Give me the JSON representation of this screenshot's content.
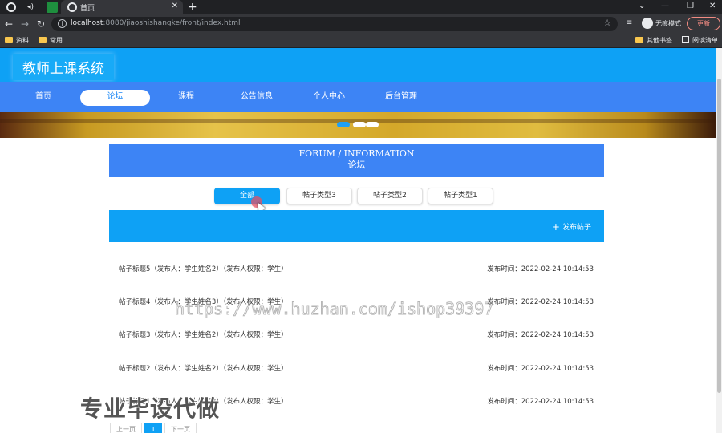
{
  "browser": {
    "tab_title": "首页",
    "url_host": "localhost",
    "url_path": ":8080/jiaoshishangke/front/index.html",
    "incognito_label": "无痕模式",
    "update_label": "更新",
    "bookmarks": [
      "资料",
      "常用"
    ],
    "other_bookmarks": "其他书签",
    "reading_list": "阅读清单"
  },
  "header": {
    "site_title": "教师上课系统"
  },
  "nav": {
    "items": [
      {
        "label": "首页"
      },
      {
        "label": "论坛"
      },
      {
        "label": "课程"
      },
      {
        "label": "公告信息"
      },
      {
        "label": "个人中心"
      },
      {
        "label": "后台管理"
      }
    ],
    "active_index": 1
  },
  "carousel": {
    "dot_count": 3,
    "active_dot": 0
  },
  "forum": {
    "title_en": "FORUM / INFORMATION",
    "title_cn": "论坛",
    "filters": [
      {
        "label": "全部"
      },
      {
        "label": "帖子类型3"
      },
      {
        "label": "帖子类型2"
      },
      {
        "label": "帖子类型1"
      }
    ],
    "active_filter": 0,
    "post_button": "发布帖子",
    "posts": [
      {
        "title": "帖子标题5（发布人：学生姓名2）（发布人权限：学生）",
        "time": "发布时间：2022-02-24 10:14:53"
      },
      {
        "title": "帖子标题4（发布人：学生姓名3）（发布人权限：学生）",
        "time": "发布时间：2022-02-24 10:14:53"
      },
      {
        "title": "帖子标题3（发布人：学生姓名2）（发布人权限：学生）",
        "time": "发布时间：2022-02-24 10:14:53"
      },
      {
        "title": "帖子标题2（发布人：学生姓名2）（发布人权限：学生）",
        "time": "发布时间：2022-02-24 10:14:53"
      },
      {
        "title": "帖子标题1（发布人：学生姓名2）（发布人权限：学生）",
        "time": "发布时间：2022-02-24 10:14:53"
      }
    ]
  },
  "pagination": {
    "prev": "上一页",
    "current": "1",
    "next": "下一页"
  },
  "overlay": {
    "watermark": "https://www.huzhan.com/ishop39397",
    "promo": "专业毕设代做"
  }
}
